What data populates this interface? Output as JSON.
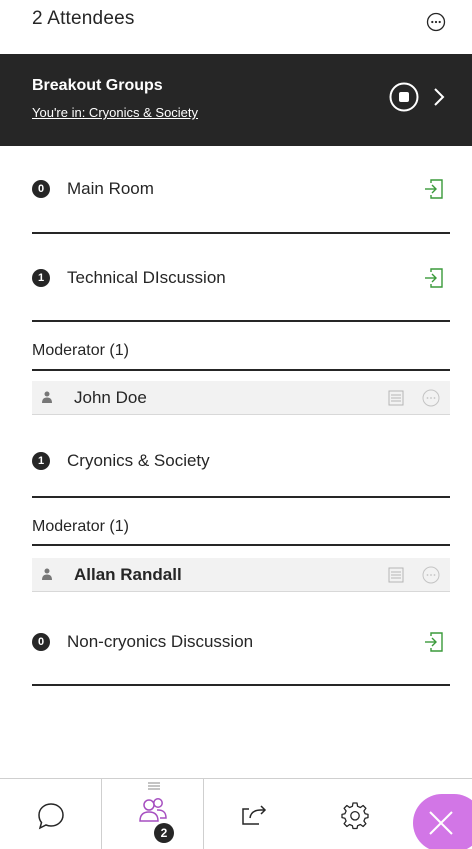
{
  "header": {
    "title": "2 Attendees"
  },
  "breakout": {
    "title": "Breakout Groups",
    "subtitle": "You're in: Cryonics & Society"
  },
  "groups": [
    {
      "count": "0",
      "name": "Main Room"
    },
    {
      "count": "1",
      "name": "Technical DIscussion"
    },
    {
      "count": "1",
      "name": "Cryonics & Society"
    },
    {
      "count": "0",
      "name": "Non-cryonics Discussion"
    }
  ],
  "technical": {
    "role": "Moderator (1)",
    "attendee": "John Doe"
  },
  "cryonics": {
    "role": "Moderator (1)",
    "attendee": "Allan Randall"
  },
  "bottom_bar": {
    "attendees_count": "2"
  },
  "colors": {
    "dark": "#262626",
    "accent_green": "#3a9a3a",
    "accent_purple": "#d276e6",
    "attendees_icon": "#a64fc0"
  },
  "icons": [
    "more-icon",
    "stop-icon",
    "chevron-right-icon",
    "join-icon",
    "person-icon",
    "list-icon",
    "chat-icon",
    "attendees-icon",
    "share-icon",
    "gear-icon",
    "close-icon"
  ]
}
